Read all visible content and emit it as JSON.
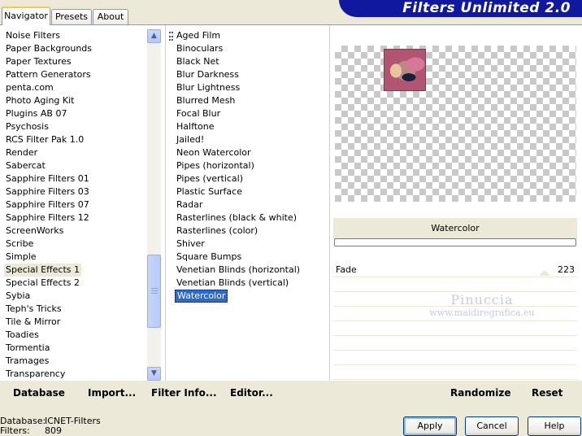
{
  "tabs": [
    {
      "label": "Navigator"
    },
    {
      "label": "Presets"
    },
    {
      "label": "About"
    }
  ],
  "title": "Filters Unlimited 2.0",
  "categories": [
    "Noise Filters",
    "Paper Backgrounds",
    "Paper Textures",
    "Pattern Generators",
    "penta.com",
    "Photo Aging Kit",
    "Plugins AB 07",
    "Psychosis",
    "RCS Filter Pak 1.0",
    "Render",
    "Sabercat",
    "Sapphire Filters 01",
    "Sapphire Filters 03",
    "Sapphire Filters 07",
    "Sapphire Filters 12",
    "ScreenWorks",
    "Scribe",
    "Simple",
    "Special Effects 1",
    "Special Effects 2",
    "Sybia",
    "Teph's Tricks",
    "Tile & Mirror",
    "Toadies",
    "Tormentia",
    "Tramages",
    "Transparency"
  ],
  "selected_category": "Special Effects 1",
  "filters": [
    "Aged Film",
    "Binoculars",
    "Black Net",
    "Blur Darkness",
    "Blur Lightness",
    "Blurred Mesh",
    "Focal Blur",
    "Halftone",
    "Jailed!",
    "Neon Watercolor",
    "Pipes (horizontal)",
    "Pipes (vertical)",
    "Plastic Surface",
    "Radar",
    "Rasterlines (black & white)",
    "Rasterlines (color)",
    "Shiver",
    "Square Bumps",
    "Venetian Blinds (horizontal)",
    "Venetian Blinds (vertical)",
    "Watercolor"
  ],
  "selected_filter": "Watercolor",
  "filter_title": "Watercolor",
  "slider": {
    "label": "Fade",
    "value": "223"
  },
  "watermark": {
    "line1": "Pinuccia",
    "line2": "www.maidiregrafica.eu"
  },
  "bottom_buttons": {
    "database": "Database",
    "import": "Import...",
    "filter_info": "Filter Info...",
    "editor": "Editor...",
    "randomize": "Randomize",
    "reset": "Reset"
  },
  "status": {
    "database_label": "Database:",
    "database_value": "ICNET-Filters",
    "filters_label": "Filters:",
    "filters_value": "809"
  },
  "dialog_buttons": {
    "apply": "Apply",
    "cancel": "Cancel",
    "help": "Help"
  },
  "colors": {
    "banner": "#10199e",
    "selection": "#316ac5"
  }
}
